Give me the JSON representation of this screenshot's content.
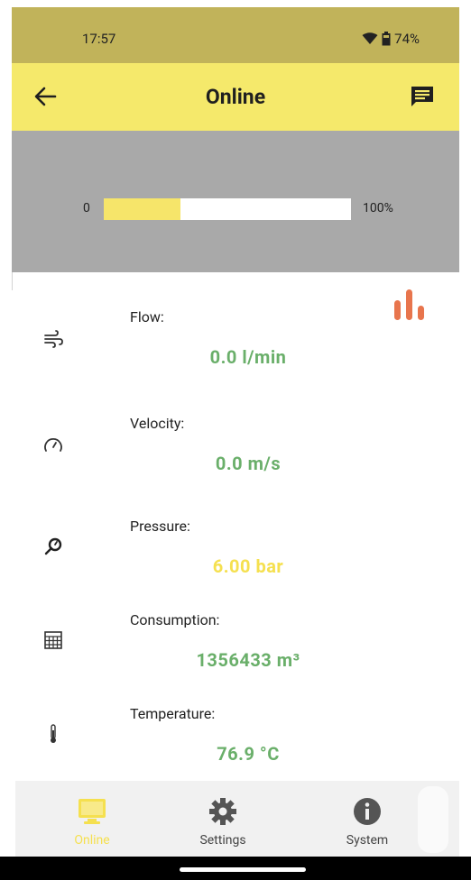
{
  "status_bar": {
    "time": "17:57",
    "battery": "74%"
  },
  "app_bar": {
    "title": "Online"
  },
  "progress": {
    "min_label": "0",
    "max_label": "100%",
    "fraction": 0.31
  },
  "readings": [
    {
      "label": "Flow:",
      "value": "0.0  l/min",
      "icon": "wind-icon",
      "color": "#6aaf6a"
    },
    {
      "label": "Velocity:",
      "value": "0.0  m/s",
      "icon": "gauge-icon",
      "color": "#6aaf6a"
    },
    {
      "label": "Pressure:",
      "value": "6.00  bar",
      "icon": "pressure-icon",
      "color": "#f5e04f"
    },
    {
      "label": "Consumption:",
      "value": "1356433  m³",
      "icon": "calculator-icon",
      "color": "#6aaf6a"
    },
    {
      "label": "Temperature:",
      "value": "76.9  °C",
      "icon": "thermometer-icon",
      "color": "#6aaf6a"
    }
  ],
  "bottom_nav": [
    {
      "label": "Online",
      "icon": "monitor-icon",
      "active": true
    },
    {
      "label": "Settings",
      "icon": "gear-icon",
      "active": false
    },
    {
      "label": "System",
      "icon": "info-icon",
      "active": false
    }
  ],
  "colors": {
    "accent": "#f5e96b",
    "status_bar": "#c1b35a",
    "chart_icon": "#e8754d"
  }
}
